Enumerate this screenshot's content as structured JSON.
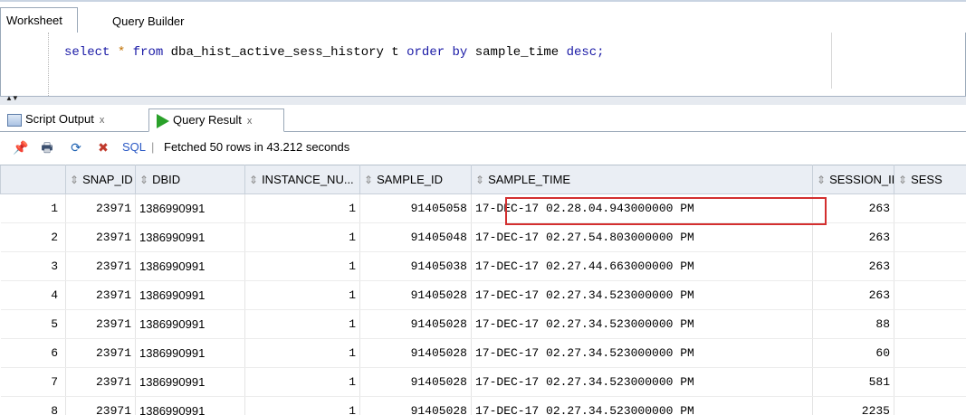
{
  "worksheet_tabs": {
    "active": "Worksheet",
    "inactive": "Query Builder"
  },
  "editor": {
    "sql_parts": [
      "select",
      "*",
      "from",
      "dba_hist_active_sess_history t",
      "order by",
      "sample_time",
      "desc;"
    ]
  },
  "result_tabs": {
    "script": {
      "label": "Script Output",
      "close": "x"
    },
    "query": {
      "label": "Query Result",
      "close": "x"
    }
  },
  "toolbar": {
    "sql_label": "SQL",
    "separator": "|",
    "status": "Fetched 50 rows in 43.212 seconds"
  },
  "grid": {
    "columns": [
      "SNAP_ID",
      "DBID",
      "INSTANCE_NU...",
      "SAMPLE_ID",
      "SAMPLE_TIME",
      "SESSION_ID",
      "SESS"
    ],
    "rows": [
      {
        "rn": "1",
        "snap_id": "23971",
        "dbid": "1386990991",
        "inst": "1",
        "sample_id": "91405058",
        "sample_time": "17-DEC-17 02.28.04.943000000 PM",
        "session_id": "263"
      },
      {
        "rn": "2",
        "snap_id": "23971",
        "dbid": "1386990991",
        "inst": "1",
        "sample_id": "91405048",
        "sample_time": "17-DEC-17 02.27.54.803000000 PM",
        "session_id": "263"
      },
      {
        "rn": "3",
        "snap_id": "23971",
        "dbid": "1386990991",
        "inst": "1",
        "sample_id": "91405038",
        "sample_time": "17-DEC-17 02.27.44.663000000 PM",
        "session_id": "263"
      },
      {
        "rn": "4",
        "snap_id": "23971",
        "dbid": "1386990991",
        "inst": "1",
        "sample_id": "91405028",
        "sample_time": "17-DEC-17 02.27.34.523000000 PM",
        "session_id": "263"
      },
      {
        "rn": "5",
        "snap_id": "23971",
        "dbid": "1386990991",
        "inst": "1",
        "sample_id": "91405028",
        "sample_time": "17-DEC-17 02.27.34.523000000 PM",
        "session_id": "88"
      },
      {
        "rn": "6",
        "snap_id": "23971",
        "dbid": "1386990991",
        "inst": "1",
        "sample_id": "91405028",
        "sample_time": "17-DEC-17 02.27.34.523000000 PM",
        "session_id": "60"
      },
      {
        "rn": "7",
        "snap_id": "23971",
        "dbid": "1386990991",
        "inst": "1",
        "sample_id": "91405028",
        "sample_time": "17-DEC-17 02.27.34.523000000 PM",
        "session_id": "581"
      },
      {
        "rn": "8",
        "snap_id": "23971",
        "dbid": "1386990991",
        "inst": "1",
        "sample_id": "91405028",
        "sample_time": "17-DEC-17 02.27.34.523000000 PM",
        "session_id": "2235"
      }
    ]
  },
  "icons": {
    "pin": "pin-icon",
    "print": "print-icon",
    "refresh": "refresh-icon",
    "delete": "delete-icon",
    "script_tab": "script-output-icon",
    "query_tab": "run-query-icon"
  },
  "colors": {
    "highlight_box": "#d32f2f",
    "keyword": "#1a1aa6",
    "pin": "#d0121b"
  }
}
